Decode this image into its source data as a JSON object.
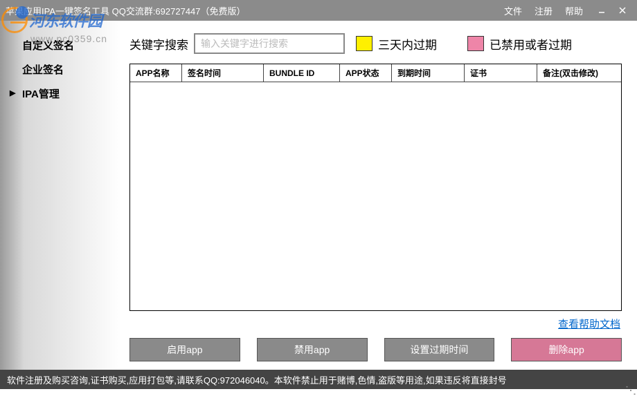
{
  "titlebar": {
    "title": "苹果应用IPA一键签名工具 QQ交流群:692727447（免费版）",
    "menu": {
      "file": "文件",
      "register": "注册",
      "help": "帮助"
    }
  },
  "sidebar": {
    "items": [
      {
        "label": "自定义签名"
      },
      {
        "label": "企业签名"
      },
      {
        "label": "IPA管理"
      }
    ]
  },
  "search": {
    "label": "关键字搜索",
    "placeholder": "输入关键字进行搜索"
  },
  "legend": {
    "expiring": "三天内过期",
    "disabled": "已禁用或者过期"
  },
  "table": {
    "headers": {
      "app_name": "APP名称",
      "sign_time": "签名时间",
      "bundle_id": "BUNDLE ID",
      "app_status": "APP状态",
      "expire_time": "到期时间",
      "cert": "证书",
      "remark": "备注(双击修改)"
    }
  },
  "help_link": "查看帮助文档",
  "buttons": {
    "enable": "启用app",
    "disable": "禁用app",
    "set_expire": "设置过期时间",
    "delete": "删除app"
  },
  "statusbar": "软件注册及购买咨询,证书购买,应用打包等,请联系QQ:972046040。本软件禁止用于赌博,色情,盗版等用途,如果违反将直接封号",
  "watermark": {
    "brand": "河东软件园",
    "url": "www.pc0359.cn"
  }
}
